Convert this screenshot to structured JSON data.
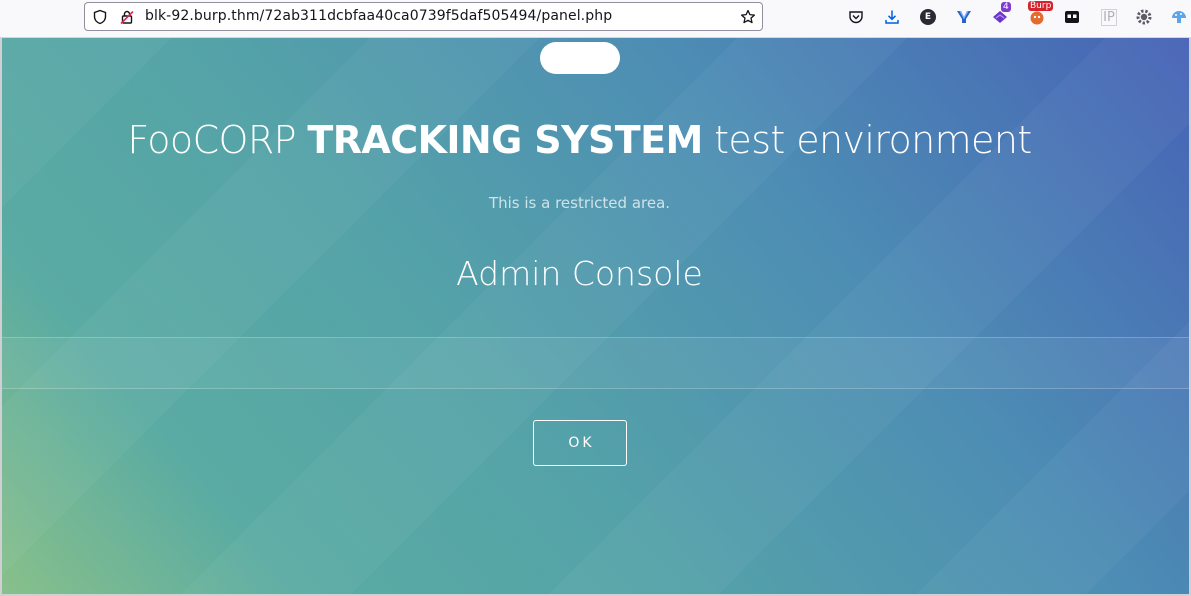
{
  "browser": {
    "url": "blk-92.burp.thm/72ab311dcbfaa40ca0739f5daf505494/panel.php",
    "extensions": {
      "badge_count": "4",
      "burp_badge": "Burp",
      "ip_label": "IP",
      "e_label": "E"
    }
  },
  "page": {
    "title_pre": "FooCORP ",
    "title_bold": "TRACKING SYSTEM",
    "title_post": " test environment",
    "subtitle": "This is a restricted area.",
    "console_heading": "Admin Console",
    "ok_label": "OK"
  },
  "colors": {
    "gradient_start": "#88c08a",
    "gradient_end": "#4763b6",
    "button_border": "#ffffff"
  }
}
